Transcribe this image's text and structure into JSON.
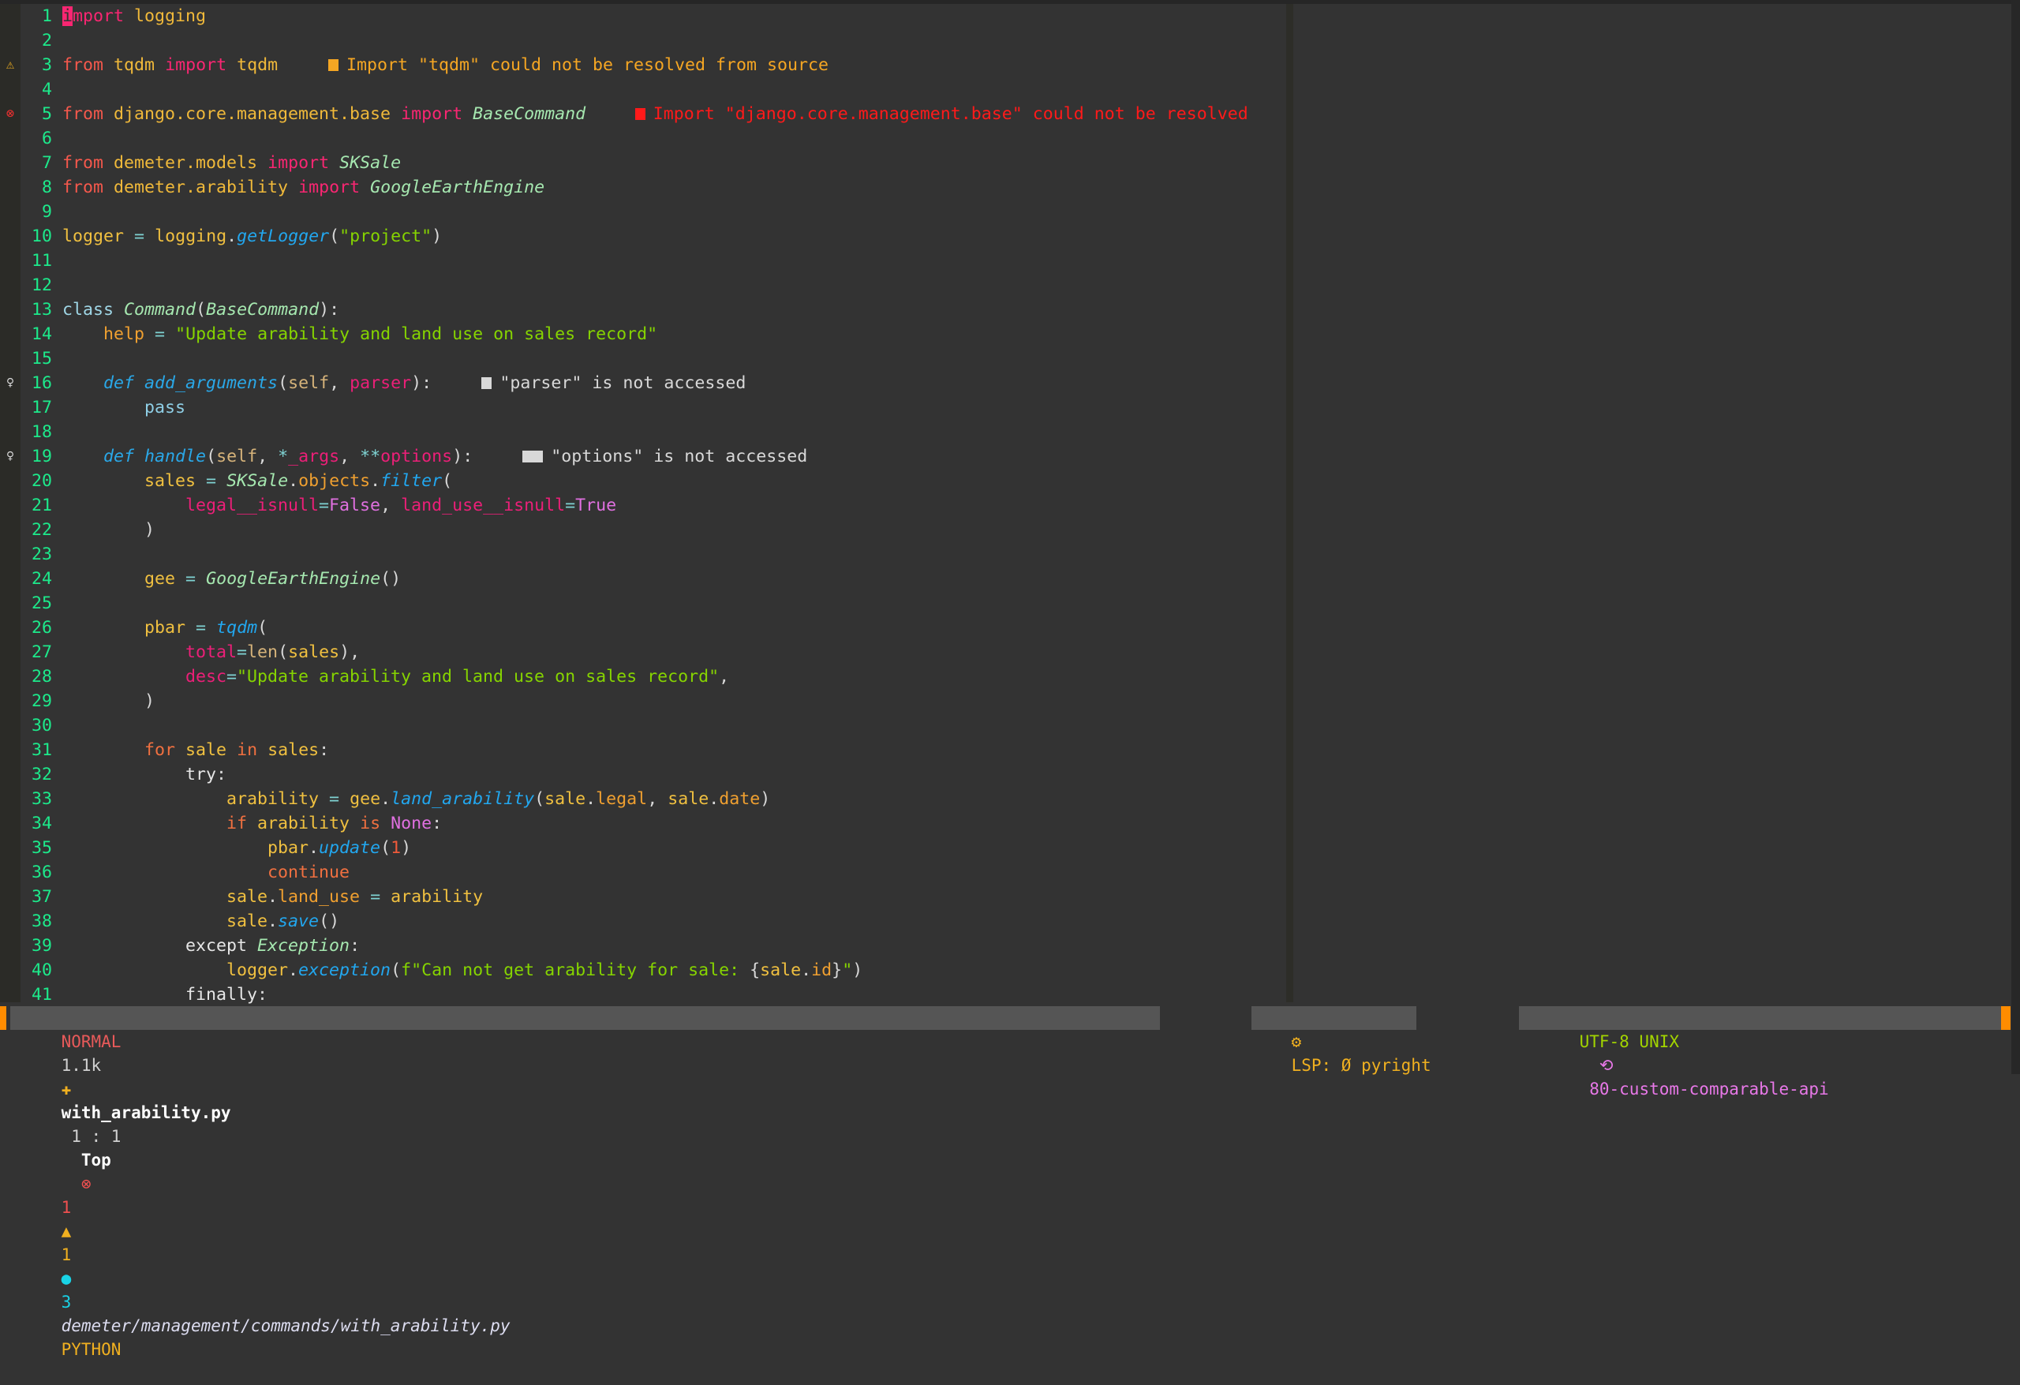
{
  "theme": {
    "background": "#333333",
    "accent": "#ff8c00",
    "cursor": "#f92672",
    "line_number": "#1de98b"
  },
  "editor": {
    "lines": [
      {
        "n": "1",
        "tokens": [
          [
            "i",
            "kw cursor"
          ],
          [
            "mport",
            "kw"
          ],
          [
            " ",
            ""
          ],
          [
            "logging",
            "id"
          ]
        ]
      },
      {
        "n": "2",
        "tokens": []
      },
      {
        "n": "3",
        "tokens": [
          [
            "from",
            "fr"
          ],
          [
            " ",
            ""
          ],
          [
            "tqdm",
            "id"
          ],
          [
            " ",
            ""
          ],
          [
            "import",
            "kw"
          ],
          [
            " ",
            ""
          ],
          [
            "tqdm",
            "id"
          ]
        ]
      },
      {
        "n": "4",
        "tokens": []
      },
      {
        "n": "5",
        "tokens": [
          [
            "from",
            "fr"
          ],
          [
            " ",
            ""
          ],
          [
            "django.core.management.base",
            "id"
          ],
          [
            " ",
            ""
          ],
          [
            "import",
            "kw"
          ],
          [
            " ",
            ""
          ],
          [
            "BaseCommand",
            "cn"
          ]
        ]
      },
      {
        "n": "6",
        "tokens": []
      },
      {
        "n": "7",
        "tokens": [
          [
            "from",
            "fr"
          ],
          [
            " ",
            ""
          ],
          [
            "demeter.models",
            "id"
          ],
          [
            " ",
            ""
          ],
          [
            "import",
            "kw"
          ],
          [
            " ",
            ""
          ],
          [
            "SKSale",
            "cn"
          ]
        ]
      },
      {
        "n": "8",
        "tokens": [
          [
            "from",
            "fr"
          ],
          [
            " ",
            ""
          ],
          [
            "demeter.arability",
            "id"
          ],
          [
            " ",
            ""
          ],
          [
            "import",
            "kw"
          ],
          [
            " ",
            ""
          ],
          [
            "GoogleEarthEngine",
            "cn"
          ]
        ]
      },
      {
        "n": "9",
        "tokens": []
      },
      {
        "n": "10",
        "tokens": [
          [
            "logger",
            "va"
          ],
          [
            " ",
            ""
          ],
          [
            "=",
            "op"
          ],
          [
            " ",
            ""
          ],
          [
            "logging",
            "va"
          ],
          [
            ".",
            "pu"
          ],
          [
            "getLogger",
            "fn"
          ],
          [
            "(",
            "pu"
          ],
          [
            "\"project\"",
            "st"
          ],
          [
            ")",
            "pu"
          ]
        ]
      },
      {
        "n": "11",
        "tokens": []
      },
      {
        "n": "12",
        "tokens": []
      },
      {
        "n": "13",
        "tokens": [
          [
            "class",
            "cl"
          ],
          [
            " ",
            ""
          ],
          [
            "Command",
            "cn"
          ],
          [
            "(",
            "pu"
          ],
          [
            "BaseCommand",
            "cn"
          ],
          [
            "):",
            "pu"
          ]
        ]
      },
      {
        "n": "14",
        "tokens": [
          [
            "    ",
            ""
          ],
          [
            "help",
            "at"
          ],
          [
            " ",
            ""
          ],
          [
            "=",
            "op"
          ],
          [
            " ",
            ""
          ],
          [
            "\"Update arability and land use on sales record\"",
            "st"
          ]
        ]
      },
      {
        "n": "15",
        "tokens": []
      },
      {
        "n": "16",
        "tokens": [
          [
            "    ",
            ""
          ],
          [
            "def",
            "df"
          ],
          [
            " ",
            ""
          ],
          [
            "add_arguments",
            "df"
          ],
          [
            "(",
            "pu"
          ],
          [
            "self",
            "sf"
          ],
          [
            ", ",
            "pu"
          ],
          [
            "parser",
            "pm"
          ],
          [
            "):",
            "pu"
          ]
        ]
      },
      {
        "n": "17",
        "tokens": [
          [
            "        ",
            ""
          ],
          [
            "pass",
            "ps"
          ]
        ]
      },
      {
        "n": "18",
        "tokens": []
      },
      {
        "n": "19",
        "tokens": [
          [
            "    ",
            ""
          ],
          [
            "def",
            "df"
          ],
          [
            " ",
            ""
          ],
          [
            "handle",
            "df"
          ],
          [
            "(",
            "pu"
          ],
          [
            "self",
            "sf"
          ],
          [
            ", ",
            "pu"
          ],
          [
            "*",
            "op"
          ],
          [
            "_args",
            "pm"
          ],
          [
            ", ",
            "pu"
          ],
          [
            "**",
            "op"
          ],
          [
            "options",
            "pm"
          ],
          [
            "):",
            "pu"
          ]
        ]
      },
      {
        "n": "20",
        "tokens": [
          [
            "        ",
            ""
          ],
          [
            "sales",
            "va"
          ],
          [
            " ",
            ""
          ],
          [
            "=",
            "op"
          ],
          [
            " ",
            ""
          ],
          [
            "SKSale",
            "cn"
          ],
          [
            ".",
            "pu"
          ],
          [
            "objects",
            "at"
          ],
          [
            ".",
            "pu"
          ],
          [
            "filter",
            "fn"
          ],
          [
            "(",
            "pu"
          ]
        ]
      },
      {
        "n": "21",
        "tokens": [
          [
            "            ",
            ""
          ],
          [
            "legal__isnull",
            "ka"
          ],
          [
            "=",
            "op"
          ],
          [
            "False",
            "bo"
          ],
          [
            ", ",
            "pu"
          ],
          [
            "land_use__isnull",
            "ka"
          ],
          [
            "=",
            "op"
          ],
          [
            "True",
            "bo"
          ]
        ]
      },
      {
        "n": "22",
        "tokens": [
          [
            "        ",
            ""
          ],
          [
            ")",
            "pu"
          ]
        ]
      },
      {
        "n": "23",
        "tokens": []
      },
      {
        "n": "24",
        "tokens": [
          [
            "        ",
            ""
          ],
          [
            "gee",
            "va"
          ],
          [
            " ",
            ""
          ],
          [
            "=",
            "op"
          ],
          [
            " ",
            ""
          ],
          [
            "GoogleEarthEngine",
            "cn"
          ],
          [
            "()",
            "pu"
          ]
        ]
      },
      {
        "n": "25",
        "tokens": []
      },
      {
        "n": "26",
        "tokens": [
          [
            "        ",
            ""
          ],
          [
            "pbar",
            "va"
          ],
          [
            " ",
            ""
          ],
          [
            "=",
            "op"
          ],
          [
            " ",
            ""
          ],
          [
            "tqdm",
            "fn"
          ],
          [
            "(",
            "pu"
          ]
        ]
      },
      {
        "n": "27",
        "tokens": [
          [
            "            ",
            ""
          ],
          [
            "total",
            "ka"
          ],
          [
            "=",
            "op"
          ],
          [
            "len",
            "bi"
          ],
          [
            "(",
            "pu"
          ],
          [
            "sales",
            "va"
          ],
          [
            "),",
            "pu"
          ]
        ]
      },
      {
        "n": "28",
        "tokens": [
          [
            "            ",
            ""
          ],
          [
            "desc",
            "ka"
          ],
          [
            "=",
            "op"
          ],
          [
            "\"Update arability and land use on sales record\"",
            "st"
          ],
          [
            ",",
            "pu"
          ]
        ]
      },
      {
        "n": "29",
        "tokens": [
          [
            "        ",
            ""
          ],
          [
            ")",
            "pu"
          ]
        ]
      },
      {
        "n": "30",
        "tokens": []
      },
      {
        "n": "31",
        "tokens": [
          [
            "        ",
            ""
          ],
          [
            "for",
            "ko"
          ],
          [
            " ",
            ""
          ],
          [
            "sale",
            "va"
          ],
          [
            " ",
            ""
          ],
          [
            "in",
            "ko"
          ],
          [
            " ",
            ""
          ],
          [
            "sales",
            "va"
          ],
          [
            ":",
            "pu"
          ]
        ]
      },
      {
        "n": "32",
        "tokens": [
          [
            "            ",
            ""
          ],
          [
            "try",
            "ex"
          ],
          [
            ":",
            "pu"
          ]
        ]
      },
      {
        "n": "33",
        "tokens": [
          [
            "                ",
            ""
          ],
          [
            "arability",
            "va"
          ],
          [
            " ",
            ""
          ],
          [
            "=",
            "op"
          ],
          [
            " ",
            ""
          ],
          [
            "gee",
            "va"
          ],
          [
            ".",
            "pu"
          ],
          [
            "land_arability",
            "fn"
          ],
          [
            "(",
            "pu"
          ],
          [
            "sale",
            "va"
          ],
          [
            ".",
            "pu"
          ],
          [
            "legal",
            "at"
          ],
          [
            ", ",
            "pu"
          ],
          [
            "sale",
            "va"
          ],
          [
            ".",
            "pu"
          ],
          [
            "date",
            "at"
          ],
          [
            ")",
            "pu"
          ]
        ]
      },
      {
        "n": "34",
        "tokens": [
          [
            "                ",
            ""
          ],
          [
            "if",
            "ko"
          ],
          [
            " ",
            ""
          ],
          [
            "arability",
            "va"
          ],
          [
            " ",
            ""
          ],
          [
            "is",
            "ko"
          ],
          [
            " ",
            ""
          ],
          [
            "None",
            "bo"
          ],
          [
            ":",
            "pu"
          ]
        ]
      },
      {
        "n": "35",
        "tokens": [
          [
            "                    ",
            ""
          ],
          [
            "pbar",
            "va"
          ],
          [
            ".",
            "pu"
          ],
          [
            "update",
            "fn"
          ],
          [
            "(",
            "pu"
          ],
          [
            "1",
            "nu"
          ],
          [
            ")",
            "pu"
          ]
        ]
      },
      {
        "n": "36",
        "tokens": [
          [
            "                    ",
            ""
          ],
          [
            "continue",
            "ko"
          ]
        ]
      },
      {
        "n": "37",
        "tokens": [
          [
            "                ",
            ""
          ],
          [
            "sale",
            "va"
          ],
          [
            ".",
            "pu"
          ],
          [
            "land_use",
            "at"
          ],
          [
            " ",
            ""
          ],
          [
            "=",
            "op"
          ],
          [
            " ",
            ""
          ],
          [
            "arability",
            "va"
          ]
        ]
      },
      {
        "n": "38",
        "tokens": [
          [
            "                ",
            ""
          ],
          [
            "sale",
            "va"
          ],
          [
            ".",
            "pu"
          ],
          [
            "save",
            "fn"
          ],
          [
            "()",
            "pu"
          ]
        ]
      },
      {
        "n": "39",
        "tokens": [
          [
            "            ",
            ""
          ],
          [
            "except",
            "ex"
          ],
          [
            " ",
            ""
          ],
          [
            "Exception",
            "cn"
          ],
          [
            ":",
            "pu"
          ]
        ]
      },
      {
        "n": "40",
        "tokens": [
          [
            "                ",
            ""
          ],
          [
            "logger",
            "va"
          ],
          [
            ".",
            "pu"
          ],
          [
            "exception",
            "fn"
          ],
          [
            "(",
            "pu"
          ],
          [
            "f\"Can not get arability for sale: ",
            "st"
          ],
          [
            "{",
            "pu"
          ],
          [
            "sale",
            "va"
          ],
          [
            ".",
            "pu"
          ],
          [
            "id",
            "at"
          ],
          [
            "}",
            "pu"
          ],
          [
            "\"",
            "st"
          ],
          [
            ")",
            "pu"
          ]
        ]
      },
      {
        "n": "41",
        "tokens": [
          [
            "            ",
            ""
          ],
          [
            "finally",
            "ex"
          ],
          [
            ":",
            "pu"
          ]
        ]
      }
    ],
    "signs": [
      {
        "line": 3,
        "icon": "warning-icon",
        "glyph": "⚠",
        "color": "#f0b020"
      },
      {
        "line": 5,
        "icon": "error-icon",
        "glyph": "⊗",
        "color": "#f03030"
      },
      {
        "line": 16,
        "icon": "lightbulb-icon",
        "glyph": "♀",
        "color": "#d8d8d8"
      },
      {
        "line": 19,
        "icon": "lightbulb-icon",
        "glyph": "♀",
        "color": "#d8d8d8"
      }
    ],
    "diagnostics": [
      {
        "line": 3,
        "severity": "warning",
        "message": "Import \"tqdm\" could not be resolved from source",
        "color": "#f5a623"
      },
      {
        "line": 5,
        "severity": "error",
        "message": "Import \"django.core.management.base\" could not be resolved",
        "color": "#ff1a1a"
      },
      {
        "line": 16,
        "severity": "hint",
        "message": "\"parser\" is not accessed",
        "color": "#d8d8d8"
      },
      {
        "line": 19,
        "severity": "hint",
        "message": "\"options\" is not accessed",
        "color": "#d8d8d8"
      }
    ]
  },
  "statusline": {
    "mode": "NORMAL",
    "size": "1.1k",
    "file_icon": "python-icon",
    "filename": "with_arability.py",
    "position": "1 : 1",
    "scroll": "Top",
    "errors": "1",
    "warnings": "1",
    "info": "3",
    "path": "demeter/management/commands/with_arability.py",
    "filetype": "PYTHON",
    "lsp": "LSP: Ø pyright",
    "encoding": "UTF-8 UNIX",
    "branch_icon": "git-branch-icon",
    "branch": "80-custom-comparable-api"
  }
}
